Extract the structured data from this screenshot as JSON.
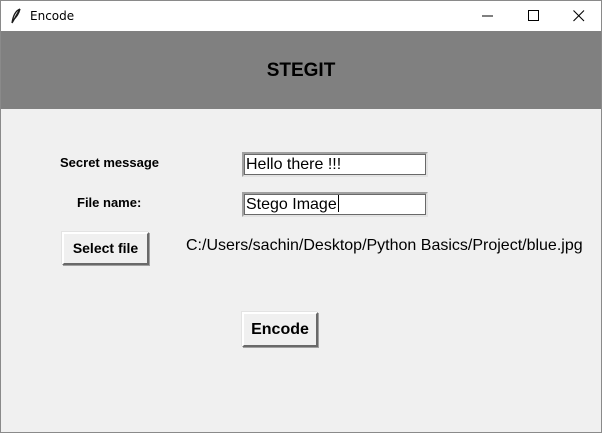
{
  "window": {
    "title": "Encode",
    "icon": "feather-icon",
    "controls": [
      "minimize",
      "maximize",
      "close"
    ]
  },
  "header": {
    "title": "STEGIT",
    "background": "#808080"
  },
  "form": {
    "secret_label": "Secret message",
    "secret_value": "Hello there !!!",
    "file_label": "File name:",
    "file_value": "Stego Image",
    "select_button": "Select file",
    "selected_path": "C:/Users/sachin/Desktop/Python Basics/Project/blue.jpg",
    "encode_button": "Encode"
  }
}
